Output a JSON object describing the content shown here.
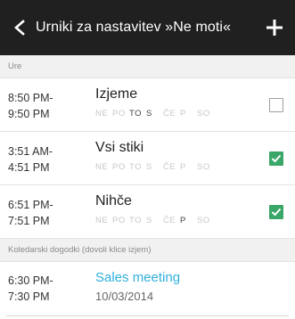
{
  "appbar": {
    "title": "Urniki za nastavitev »Ne moti«",
    "back_icon": "chevron-left-icon",
    "add_icon": "plus-icon"
  },
  "sections": {
    "schedules_header": "Ure",
    "events_header": "Koledarski dogodki (dovoli klice izjem)"
  },
  "schedules": [
    {
      "start": "8:50 PM-",
      "end": "9:50 PM",
      "name": "Izjeme",
      "days": [
        {
          "label": "NE",
          "on": false
        },
        {
          "label": "PO",
          "on": false
        },
        {
          "label": "TO",
          "on": true
        },
        {
          "label": "S",
          "on": true
        },
        {
          "label": "ČE",
          "on": false
        },
        {
          "label": "P",
          "on": false
        },
        {
          "label": "SO",
          "on": false
        }
      ],
      "checked": false
    },
    {
      "start": "3:51 AM-",
      "end": "4:51 PM",
      "name": "Vsi stiki",
      "days": [
        {
          "label": "NE",
          "on": false
        },
        {
          "label": "PO",
          "on": false
        },
        {
          "label": "TO",
          "on": false
        },
        {
          "label": "S",
          "on": false
        },
        {
          "label": "ČE",
          "on": false
        },
        {
          "label": "P",
          "on": false
        },
        {
          "label": "SO",
          "on": false
        }
      ],
      "checked": true
    },
    {
      "start": "6:51 PM-",
      "end": "7:51 PM",
      "name": "Nihče",
      "days": [
        {
          "label": "NE",
          "on": false
        },
        {
          "label": "PO",
          "on": false
        },
        {
          "label": "TO",
          "on": false
        },
        {
          "label": "S",
          "on": false
        },
        {
          "label": "ČE",
          "on": false
        },
        {
          "label": "P",
          "on": true
        },
        {
          "label": "SO",
          "on": false
        }
      ],
      "checked": true
    }
  ],
  "events": [
    {
      "start": "6:30 PM-",
      "end": "7:30 PM",
      "name": "Sales meeting",
      "date": "10/03/2014"
    }
  ],
  "colors": {
    "appbar_bg": "#202020",
    "checkbox_checked": "#3aa768",
    "event_accent": "#30b0dc"
  }
}
